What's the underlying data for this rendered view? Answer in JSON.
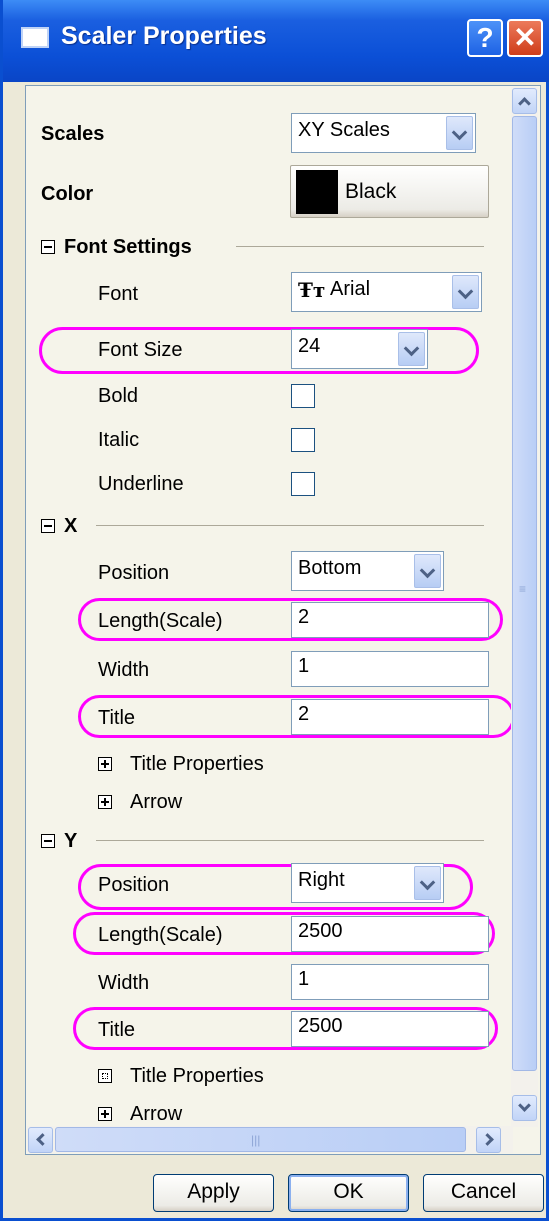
{
  "window": {
    "title": "Scaler Properties",
    "help_glyph": "?",
    "close_glyph": "✕"
  },
  "properties": {
    "scales_label": "Scales",
    "scales_value": "XY Scales",
    "color_label": "Color",
    "color_value": "Black",
    "color_swatch": "#000000",
    "font_settings": {
      "header": "Font Settings",
      "font_label": "Font",
      "font_icon_glyph": "Ŧт",
      "font_value": "Arial",
      "font_size_label": "Font Size",
      "font_size_value": "24",
      "bold_label": "Bold",
      "bold_checked": false,
      "italic_label": "Italic",
      "italic_checked": false,
      "underline_label": "Underline",
      "underline_checked": false
    },
    "x": {
      "header": "X",
      "position_label": "Position",
      "position_value": "Bottom",
      "length_label": "Length(Scale)",
      "length_value": "2",
      "width_label": "Width",
      "width_value": "1",
      "title_label": "Title",
      "title_value": "2",
      "title_properties_label": "Title Properties",
      "arrow_label": "Arrow"
    },
    "y": {
      "header": "Y",
      "position_label": "Position",
      "position_value": "Right",
      "length_label": "Length(Scale)",
      "length_value": "2500",
      "width_label": "Width",
      "width_value": "1",
      "title_label": "Title",
      "title_value": "2500",
      "title_properties_label": "Title Properties",
      "arrow_label": "Arrow"
    }
  },
  "scrollbar": {
    "grip": "≡",
    "hgrip": "|||"
  },
  "buttons": {
    "apply": "Apply",
    "ok": "OK",
    "cancel": "Cancel"
  },
  "colors": {
    "highlight": "#ff00ff",
    "titlebar": "#0b4fd6",
    "close": "#cf3d1a"
  }
}
